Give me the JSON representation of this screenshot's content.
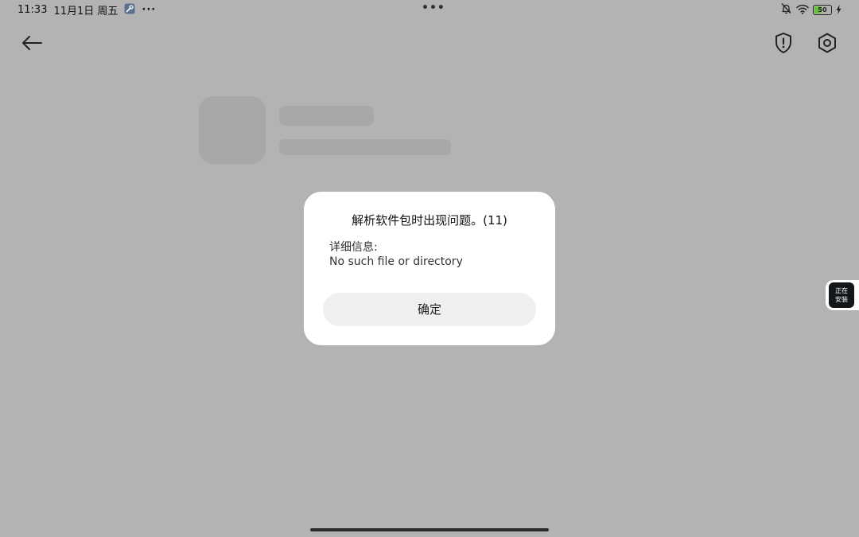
{
  "status_bar": {
    "time": "11:33",
    "date": "11月1日 周五",
    "more_dots": "···",
    "center_dots": "•••",
    "battery_level": 50
  },
  "dialog": {
    "title": "解析软件包时出现问题。(11)",
    "details_label": "详细信息:",
    "message": "No such file or directory",
    "confirm_label": "确定"
  },
  "floating_widget": {
    "line1": "正在",
    "line2": "安装"
  },
  "colors": {
    "background": "#b3b3b3",
    "battery_fill": "#6abf3c"
  }
}
